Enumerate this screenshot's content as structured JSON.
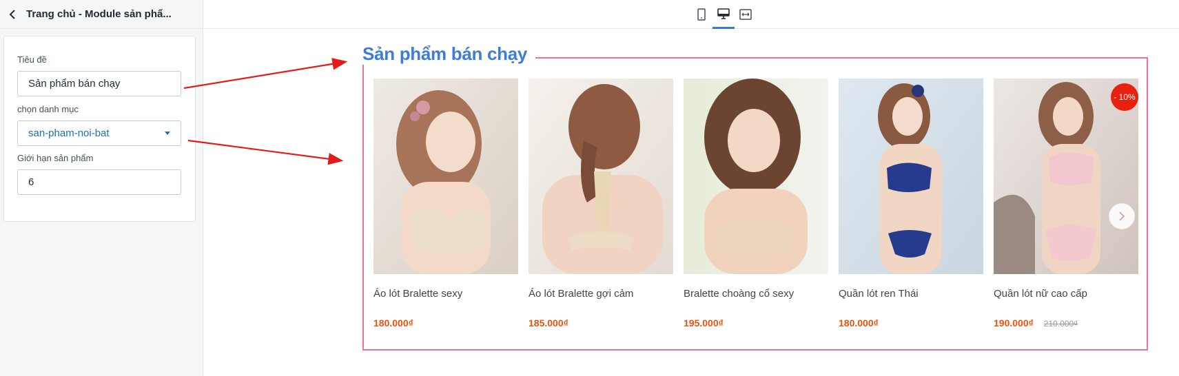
{
  "sidebar": {
    "title": "Trang chủ - Module sản phẩ...",
    "fields": {
      "title_label": "Tiêu đề",
      "title_value": "Sản phẩm bán chạy",
      "category_label": "chọn danh mục",
      "category_value": "san-pham-noi-bat",
      "limit_label": "Giới hạn sản phẩm",
      "limit_value": "6"
    }
  },
  "toolbar": {
    "devices": [
      "mobile-icon",
      "desktop-icon",
      "fullwidth-icon"
    ],
    "active_device": "desktop-icon"
  },
  "section": {
    "title": "Sản phẩm bán chạy",
    "products": [
      {
        "name": "Áo lót Bralette sexy",
        "price": "180.000₫",
        "old_price": ""
      },
      {
        "name": "Áo lót Bralette gợi cảm",
        "price": "185.000₫",
        "old_price": ""
      },
      {
        "name": "Bralette choàng cổ sexy",
        "price": "195.000₫",
        "old_price": ""
      },
      {
        "name": "Quần lót ren Thái",
        "price": "180.000₫",
        "old_price": ""
      },
      {
        "name": "Quần lót nữ cao cấp",
        "price": "190.000₫",
        "old_price": "210.000₫",
        "badge": "- 10%"
      }
    ]
  },
  "colors": {
    "accent": "#2c7be5",
    "title": "#3f7cd9",
    "frame": "#f06ca5",
    "price": "#e8520d",
    "badge": "#e8210f",
    "annotation_arrow": "#e31b1b"
  }
}
